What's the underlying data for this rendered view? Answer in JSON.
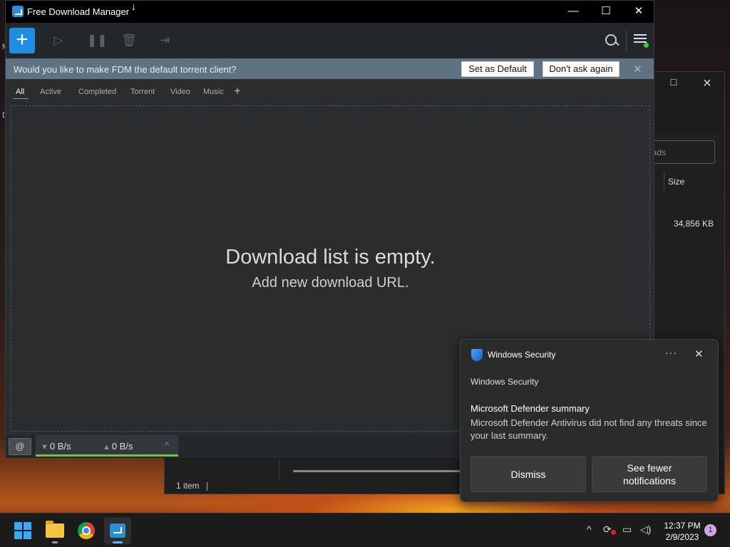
{
  "desktop": {
    "fragment_m": "M",
    "fragment_d": "D"
  },
  "explorer": {
    "search_placeholder": "oads",
    "column_size": "Size",
    "row_size": "34,856 KB",
    "status_items": "1 item"
  },
  "fdm": {
    "title": "Free Download Manager",
    "window_controls": {
      "minimize": "—",
      "maximize": "☐",
      "close": "✕"
    },
    "toolbar": {
      "add": "+",
      "icons": [
        "play-icon",
        "pause-icon",
        "trash-icon",
        "move-folder-icon",
        "search-icon",
        "menu-icon"
      ]
    },
    "banner": {
      "message": "Would you like to make FDM the default torrent client?",
      "set_default": "Set as Default",
      "dont_ask": "Don't ask again",
      "close": "✕"
    },
    "tabs": [
      {
        "label": "All",
        "active": true
      },
      {
        "label": "Active",
        "active": false
      },
      {
        "label": "Completed",
        "active": false
      },
      {
        "label": "Torrent",
        "active": false
      },
      {
        "label": "Video",
        "active": false
      },
      {
        "label": "Music",
        "active": false
      }
    ],
    "tab_add": "+",
    "empty": {
      "title": "Download list is empty.",
      "subtitle": "Add new download URL."
    },
    "status": {
      "download_speed": "0 B/s",
      "upload_speed": "0 B/s"
    }
  },
  "notification": {
    "app_name": "Windows Security",
    "more": "···",
    "close": "✕",
    "source": "Windows Security",
    "heading": "Microsoft Defender summary",
    "body": "Microsoft Defender Antivirus did not find any threats since your last summary.",
    "dismiss": "Dismiss",
    "see_fewer_line1": "See fewer",
    "see_fewer_line2": "notifications"
  },
  "taskbar": {
    "apps": [
      "start-icon",
      "file-explorer-icon",
      "chrome-icon",
      "fdm-icon"
    ],
    "time": "12:37 PM",
    "date": "2/9/2023",
    "notification_count": "1"
  },
  "colors": {
    "accent": "#1f8de0",
    "banner": "#5f7282",
    "speed_bar": "#6fc24a"
  }
}
